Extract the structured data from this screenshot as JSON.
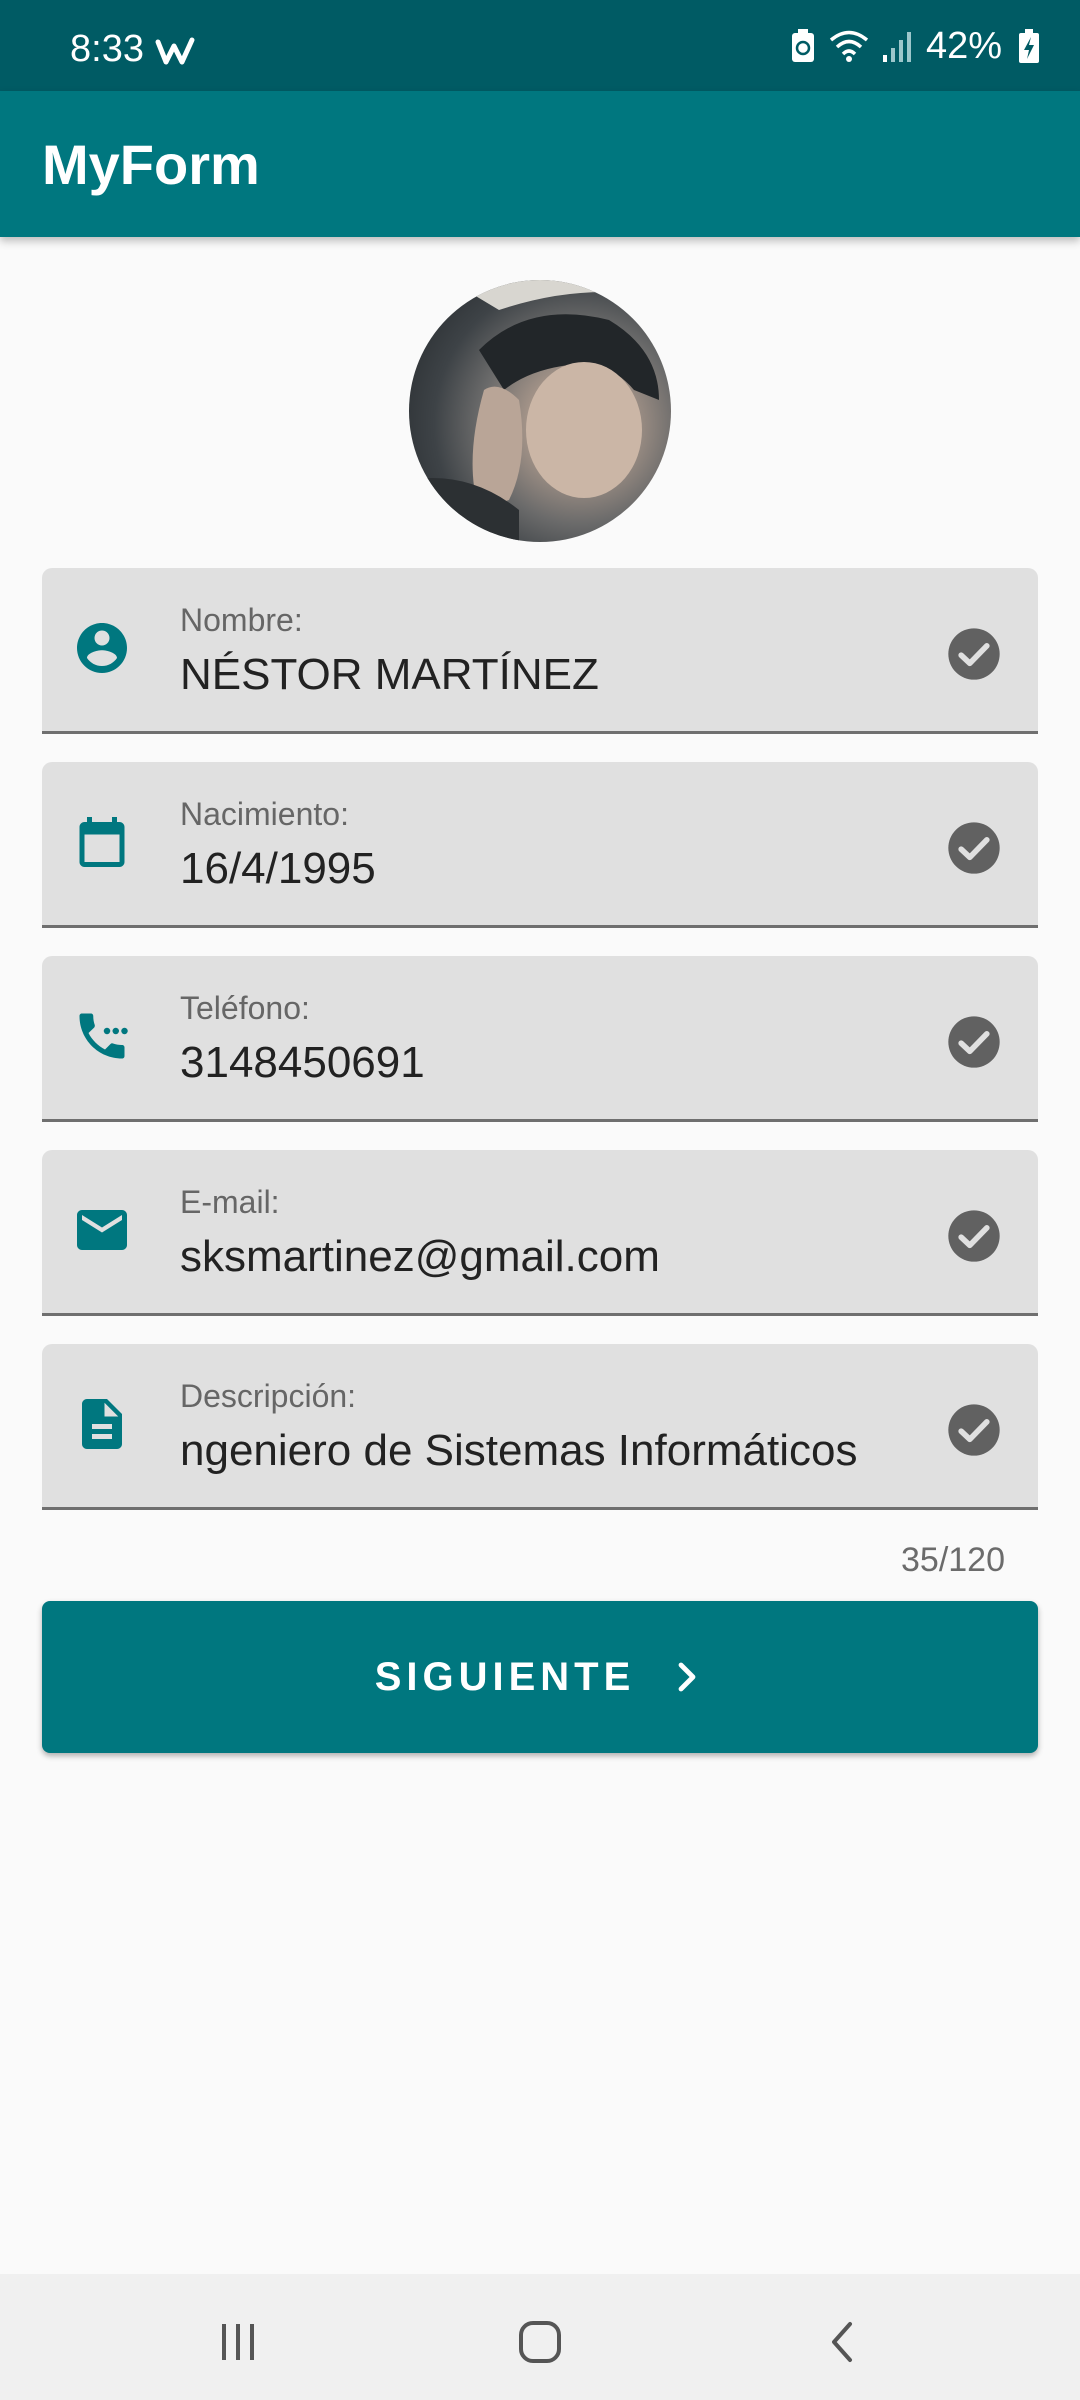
{
  "status_bar": {
    "time": "8:33",
    "battery": "42%"
  },
  "app_bar": {
    "title": "MyForm"
  },
  "form": {
    "fields": [
      {
        "label": "Nombre:",
        "value": "NÉSTOR MARTÍNEZ",
        "icon": "account-circle-icon",
        "status_icon": "check-circle-icon"
      },
      {
        "label": "Nacimiento:",
        "value": "16/4/1995",
        "icon": "calendar-icon",
        "status_icon": "check-circle-icon"
      },
      {
        "label": "Teléfono:",
        "value": "3148450691",
        "icon": "phone-icon",
        "status_icon": "check-circle-icon"
      },
      {
        "label": "E-mail:",
        "value": "sksmartinez@gmail.com",
        "icon": "email-icon",
        "status_icon": "check-circle-icon"
      },
      {
        "label": "Descripción:",
        "value": "ngeniero de Sistemas Informáticos",
        "icon": "description-icon",
        "status_icon": "check-circle-icon"
      }
    ],
    "description_counter": "35/120"
  },
  "next_button": {
    "label": "SIGUIENTE",
    "icon": "chevron-right-icon"
  },
  "colors": {
    "primary": "#00777f",
    "primary_dark": "#005b64",
    "field_bg": "#e0e0e0",
    "check": "#616161"
  }
}
